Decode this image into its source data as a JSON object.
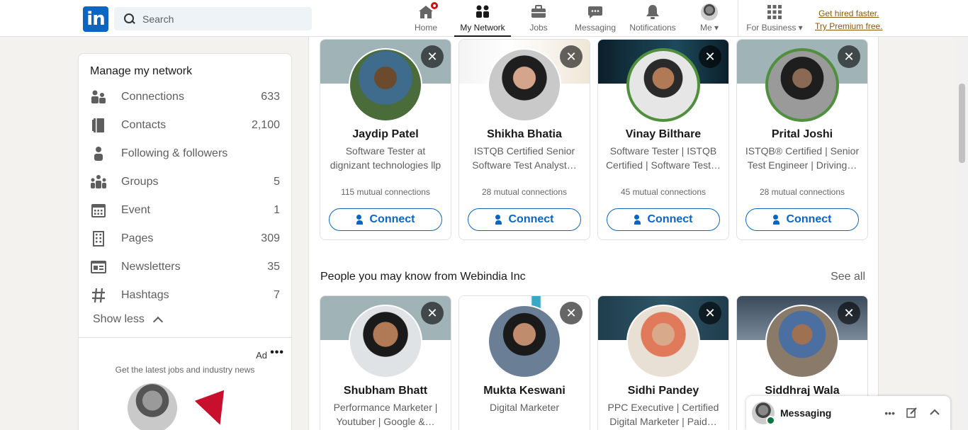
{
  "nav": {
    "search_placeholder": "Search",
    "items": [
      {
        "label": "Home"
      },
      {
        "label": "My Network"
      },
      {
        "label": "Jobs"
      },
      {
        "label": "Messaging"
      },
      {
        "label": "Notifications"
      },
      {
        "label": "Me"
      },
      {
        "label": "For Business"
      }
    ],
    "premium_line1": "Get hired faster.",
    "premium_line2": "Try Premium free."
  },
  "sidebar": {
    "title": "Manage my network",
    "items": [
      {
        "label": "Connections",
        "count": "633",
        "icon": "connections-icon"
      },
      {
        "label": "Contacts",
        "count": "2,100",
        "icon": "contacts-icon"
      },
      {
        "label": "Following & followers",
        "count": "",
        "icon": "person-icon"
      },
      {
        "label": "Groups",
        "count": "5",
        "icon": "groups-icon"
      },
      {
        "label": "Event",
        "count": "1",
        "icon": "calendar-icon"
      },
      {
        "label": "Pages",
        "count": "309",
        "icon": "building-icon"
      },
      {
        "label": "Newsletters",
        "count": "35",
        "icon": "newspaper-icon"
      },
      {
        "label": "Hashtags",
        "count": "7",
        "icon": "hashtag-icon"
      }
    ],
    "show_less": "Show less"
  },
  "ad": {
    "label": "Ad",
    "text": "Get the latest jobs and industry news"
  },
  "cards_top": [
    {
      "name": "Jaydip Patel",
      "headline": "Software Tester at dignizant technologies llp",
      "mutual": "115 mutual connections",
      "connect": "Connect"
    },
    {
      "name": "Shikha Bhatia",
      "headline": "ISTQB Certified Senior Software Test Analyst…",
      "mutual": "28 mutual connections",
      "connect": "Connect"
    },
    {
      "name": "Vinay Bilthare",
      "headline": "Software Tester | ISTQB Certified | Software Test…",
      "mutual": "45 mutual connections",
      "connect": "Connect"
    },
    {
      "name": "Prital Joshi",
      "headline": "ISTQB® Certified | Senior Test Engineer | Driving…",
      "mutual": "28 mutual connections",
      "connect": "Connect"
    }
  ],
  "section": {
    "title": "People you may know from Webindia Inc",
    "see_all": "See all"
  },
  "cards_bottom": [
    {
      "name": "Shubham Bhatt",
      "headline": "Performance Marketer | Youtuber | Google &…"
    },
    {
      "name": "Mukta Keswani",
      "headline": "Digital Marketer"
    },
    {
      "name": "Sidhi Pandey",
      "headline": "PPC Executive | Certified Digital Marketer | Paid…"
    },
    {
      "name": "Siddhraj Wala",
      "headline": ""
    }
  ],
  "opentowork": "#OPENTOWORK",
  "messaging": {
    "title": "Messaging"
  },
  "colors": {
    "brand": "#0a66c2",
    "premium": "#915907",
    "badge": "#cc1016"
  }
}
